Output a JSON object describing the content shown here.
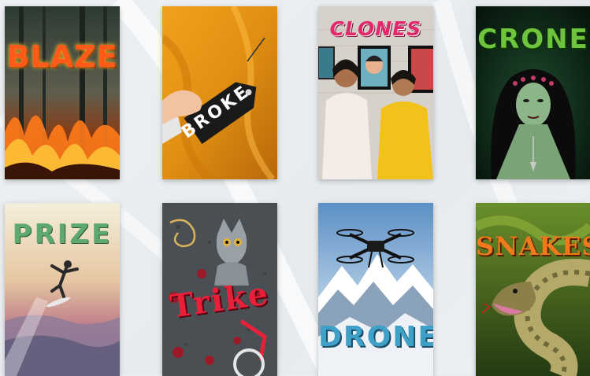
{
  "books": [
    {
      "title": "BLAZE",
      "theme": "forest-fire"
    },
    {
      "title": "BROKE",
      "theme": "price-tag"
    },
    {
      "title": "CLONES",
      "theme": "twins-comic"
    },
    {
      "title": "CRONE",
      "theme": "witch"
    },
    {
      "title": "PRIZE",
      "theme": "surfer-sunset"
    },
    {
      "title": "Trike",
      "theme": "cat-tricycle"
    },
    {
      "title": "DRONES",
      "theme": "drone-mountains"
    },
    {
      "title": "SNAKES",
      "theme": "snake-jungle"
    }
  ],
  "colors": {
    "background": "#e9edf1",
    "blaze": "#ff5a17",
    "clones": "#e0286b",
    "crone": "#6fc43d",
    "prize": "#5ea970",
    "trike": "#e8203a",
    "drones": "#3fa0c8",
    "snakes": "#f07a1b"
  }
}
